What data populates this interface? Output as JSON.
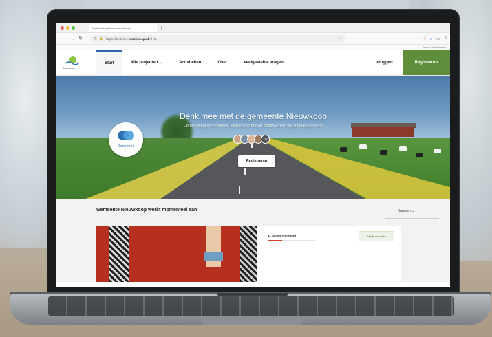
{
  "browser": {
    "tab_title": "Participatieplatform van Gemee",
    "url_prefix": "https://denkmee.",
    "url_host": "nieuwkoop.nl",
    "url_suffix": "/nl-NL",
    "bookmarks_label": "Andere bladwijzers"
  },
  "site": {
    "logo_text": "Nieuwkoop",
    "nav": [
      "Start",
      "Alle projecten",
      "Activiteiten",
      "Over",
      "Veelgestelde vragen"
    ],
    "nav_chevron": "⌄",
    "login_label": "Inloggen",
    "register_label": "Registreren"
  },
  "hero": {
    "badge_text": "Denk mee",
    "title": "Denk mee met de gemeente Nieuwkoop",
    "subtitle": "De plek waar je meedenkt, kiest en stemt over onderwerpen die jij belangrijk vindt",
    "button_label": "Registreren",
    "avatar_more": "+99"
  },
  "section": {
    "title": "Gemeente Nieuwkoop werkt momenteel aan",
    "sort_label": "Kenmen ⌄"
  },
  "card": {
    "days_left": "11 dagen resterend",
    "days_progress": 0.3,
    "view_button": "Bekijk de opties"
  },
  "colors": {
    "accent_green": "#5f8f3b",
    "active_blue": "#2e6ab0",
    "progress_red": "#d2452f"
  }
}
